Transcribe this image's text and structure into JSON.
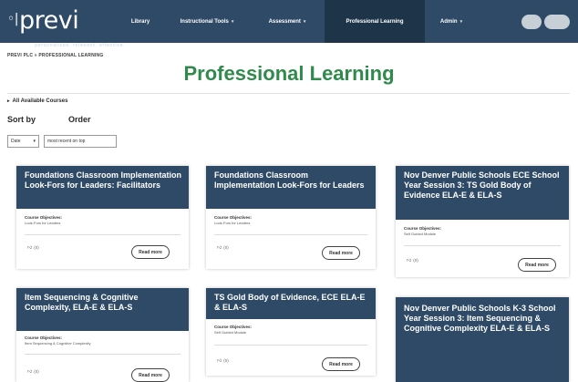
{
  "header": {
    "logo": "previ",
    "logo_tagline": "personalized. relevant. effective.",
    "nav": [
      {
        "label": "Library",
        "caret": ""
      },
      {
        "label": "Instructional Tools",
        "caret": "▾"
      },
      {
        "label": "Assessment",
        "caret": "▾"
      },
      {
        "label": "Professional Learning",
        "caret": ""
      },
      {
        "label": "Admin",
        "caret": "▾"
      }
    ]
  },
  "breadcrumb": "PREVI PLC » PROFESSIONAL LEARNING",
  "page_title": "Professional Learning",
  "section": {
    "toggle_icon": "▸",
    "label": "All Available Courses"
  },
  "controls": {
    "sort_by_label": "Sort by",
    "order_label": "Order",
    "sort_value": "Date",
    "order_value": "most recent on top"
  },
  "cards": [
    {
      "title": "Foundations Classroom Implementation Look-Fors for Leaders: Facilitators",
      "objectives_label": "Course Objectives:",
      "objectives": "Look-Fors for Leaders",
      "likes": "(0)",
      "button": "Read more"
    },
    {
      "title": "Foundations Classroom Implementation Look-Fors for Leaders",
      "objectives_label": "Course Objectives:",
      "objectives": "Look-Fors for Leaders",
      "likes": "(0)",
      "button": "Read more"
    },
    {
      "title": "Nov Denver Public Schools ECE School Year Session 3: TS Gold Body of Evidence ELA-E & ELA-S",
      "objectives_label": "Course Objectives:",
      "objectives": "Self Guided Module",
      "likes": "(0)",
      "button": "Read more"
    },
    {
      "title": "Item Sequencing & Cognitive Complexity, ELA-E & ELA-S",
      "objectives_label": "Course Objectives:",
      "objectives": "Item Sequencing & Cognitive Complexity",
      "likes": "(0)",
      "button": "Read more"
    },
    {
      "title": "TS Gold Body of Evidence, ECE ELA-E & ELA-S",
      "objectives_label": "Course Objectives:",
      "objectives": "Self Guided Module",
      "likes": "(0)",
      "button": "Read more"
    },
    {
      "title": "Nov Denver Public Schools K-3 School Year Session 3: Item Sequencing & Cognitive Complexity ELA-E & ELA-S",
      "objectives_label": "",
      "objectives": "",
      "likes": "",
      "button": ""
    }
  ]
}
